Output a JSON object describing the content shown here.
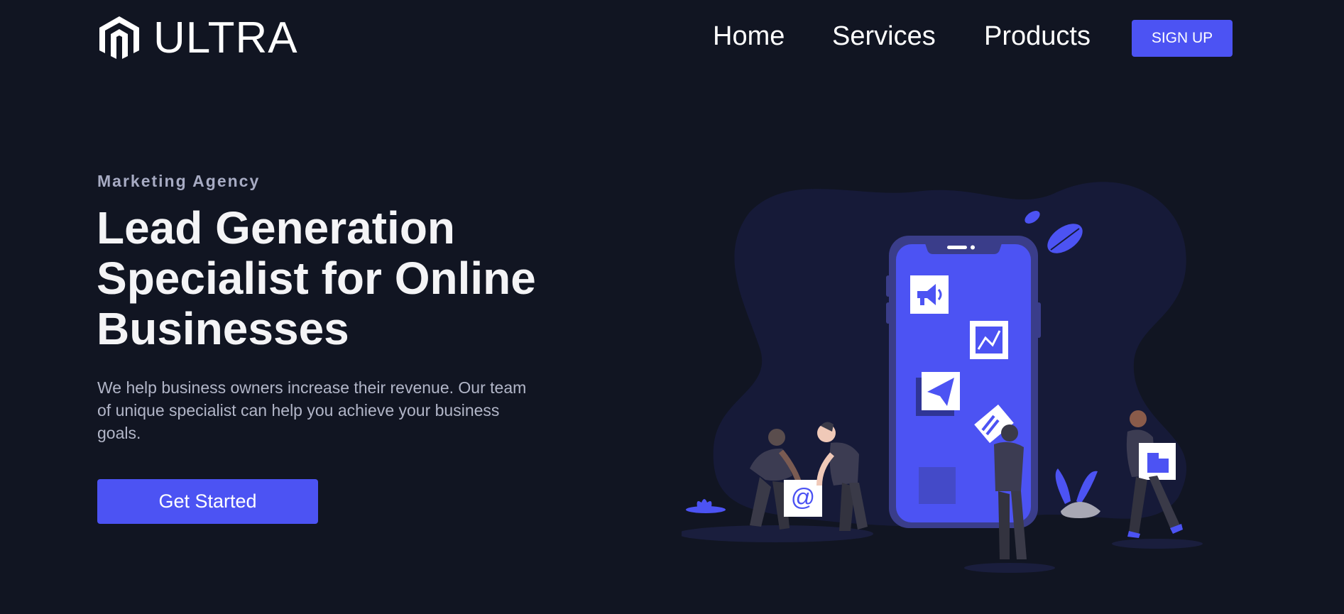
{
  "brand": {
    "name": "ULTRA",
    "logo_icon": "magento-style-logo-icon"
  },
  "nav": {
    "home": "Home",
    "services": "Services",
    "products": "Products",
    "signup": "SIGN UP"
  },
  "hero": {
    "eyebrow": "Marketing Agency",
    "headline_line1": "Lead Generation",
    "headline_line2": "Specialist for Online",
    "headline_line3": "Businesses",
    "description": "We help business owners increase their revenue. Our team of unique specialist can help you achieve your business goals.",
    "cta": "Get Started",
    "email_glyph": "@"
  },
  "colors": {
    "background": "#111522",
    "accent": "#4c53f3",
    "blob": "#161a38",
    "muted_text": "#b2b6c8"
  }
}
